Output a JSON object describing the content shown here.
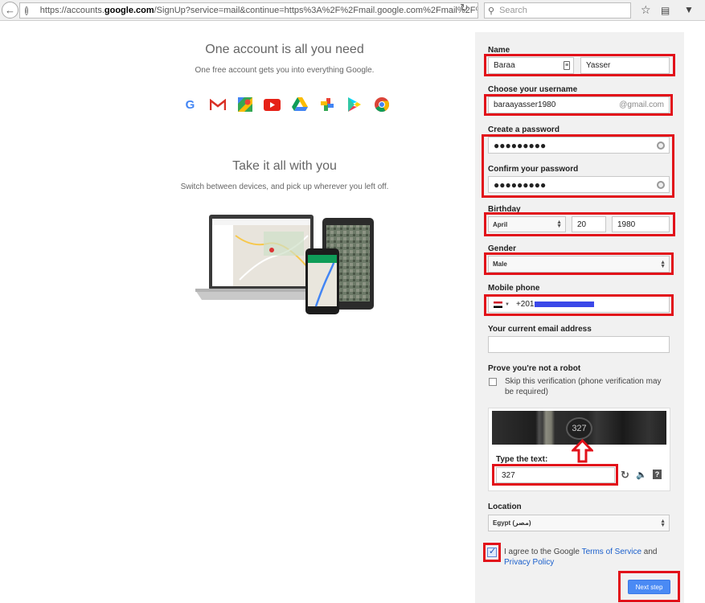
{
  "browser": {
    "url_prefix": "https://accounts.",
    "url_host": "google.com",
    "url_rest": "/SignUp?service=mail&continue=https%3A%2F%2Fmail.google.com%2Fmail%2F%",
    "search_placeholder": "Search"
  },
  "promo": {
    "title1": "One account is all you need",
    "subtitle1": "One free account gets you into everything Google.",
    "title2": "Take it all with you",
    "subtitle2": "Switch between devices, and pick up wherever you left off."
  },
  "form": {
    "name_label": "Name",
    "first_name": "Baraa",
    "last_name": "Yasser",
    "username_label": "Choose your username",
    "username": "baraayasser1980",
    "username_suffix": "@gmail.com",
    "password_label": "Create a password",
    "password_mask": "●●●●●●●●●",
    "confirm_label": "Confirm your password",
    "confirm_mask": "●●●●●●●●●",
    "birthday_label": "Birthday",
    "birth_month": "April",
    "birth_day": "20",
    "birth_year": "1980",
    "gender_label": "Gender",
    "gender": "Male",
    "phone_label": "Mobile phone",
    "phone_prefix": "+201",
    "email_label": "Your current email address",
    "email": "",
    "robot_label": "Prove you're not a robot",
    "skip_text_line1": "Skip this verification (phone verification may",
    "skip_text_line2": "be required)",
    "captcha_number": "327",
    "type_text_label": "Type the text:",
    "captcha_answer": "327",
    "location_label": "Location",
    "location": "Egypt (مصر)",
    "agree_prefix": "I agree to the Google ",
    "terms_link": "Terms of Service",
    "agree_and": " and",
    "privacy_link": "Privacy Policy",
    "next_label": "Next step"
  },
  "colors": {
    "highlight": "#e2111a",
    "button": "#4a8af4",
    "panel": "#f1f1f1"
  }
}
